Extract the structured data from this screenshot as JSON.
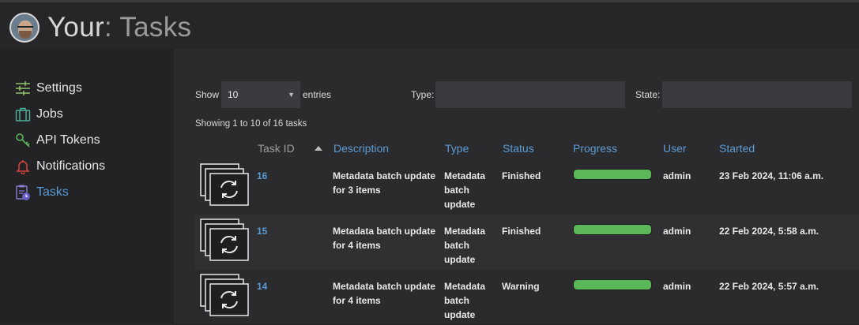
{
  "header": {
    "title_primary": "Your",
    "title_secondary": ": Tasks"
  },
  "sidebar": {
    "items": [
      {
        "label": "Settings",
        "icon": "sliders-icon"
      },
      {
        "label": "Jobs",
        "icon": "briefcase-icon"
      },
      {
        "label": "API Tokens",
        "icon": "key-icon"
      },
      {
        "label": "Notifications",
        "icon": "bell-icon"
      },
      {
        "label": "Tasks",
        "icon": "clipboard-clock-icon",
        "active": true
      }
    ]
  },
  "controls": {
    "show_label": "Show",
    "page_size": "10",
    "entries_label": "entries",
    "type_label": "Type:",
    "type_value": "",
    "state_label": "State:",
    "state_value": ""
  },
  "summary": "Showing 1 to 10 of 16 tasks",
  "table": {
    "columns": [
      "Task ID",
      "Description",
      "Type",
      "Status",
      "Progress",
      "User",
      "Started"
    ],
    "rows": [
      {
        "id": "16",
        "description": [
          "Metadata batch update",
          "for 3 items"
        ],
        "type": [
          "Metadata",
          "batch",
          "update"
        ],
        "status": "Finished",
        "progress": 1.0,
        "user": "admin",
        "started": "23 Feb 2024, 11:06 a.m."
      },
      {
        "id": "15",
        "description": [
          "Metadata batch update",
          "for 4 items"
        ],
        "type": [
          "Metadata",
          "batch",
          "update"
        ],
        "status": "Finished",
        "progress": 1.0,
        "user": "admin",
        "started": "22 Feb 2024, 5:58 a.m."
      },
      {
        "id": "14",
        "description": [
          "Metadata batch update",
          "for 4 items"
        ],
        "type": [
          "Metadata",
          "batch",
          "update"
        ],
        "status": "Warning",
        "progress": 1.0,
        "user": "admin",
        "started": "22 Feb 2024, 5:57 a.m."
      }
    ]
  },
  "colors": {
    "accent": "#5b9bd5",
    "progress_fill": "#5ab75a",
    "background": "#262628"
  }
}
